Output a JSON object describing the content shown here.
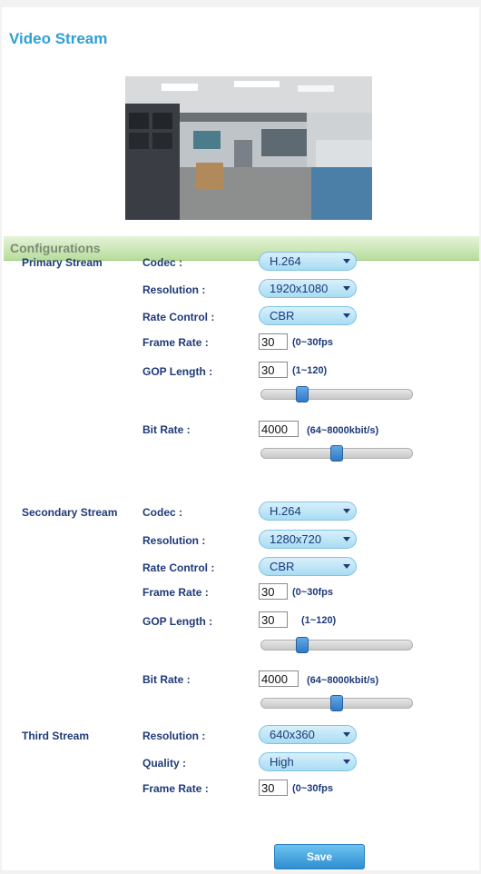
{
  "page_title": "Video Stream",
  "config_header": "Configurations",
  "primary": {
    "label": "Primary Stream",
    "codec_label": "Codec :",
    "codec": "H.264",
    "resolution_label": "Resolution :",
    "resolution": "1920x1080",
    "rate_control_label": "Rate Control :",
    "rate_control": "CBR",
    "frame_rate_label": "Frame Rate :",
    "frame_rate": "30",
    "frame_rate_range": "(0~30fps",
    "gop_label": "GOP Length :",
    "gop": "30",
    "gop_range": "(1~120)",
    "gop_slider_fraction": 0.25,
    "bit_rate_label": "Bit Rate :",
    "bit_rate": "4000",
    "bit_rate_range": "(64~8000kbit/s)",
    "bit_rate_slider_fraction": 0.5
  },
  "secondary": {
    "label": "Secondary Stream",
    "codec_label": "Codec :",
    "codec": "H.264",
    "resolution_label": "Resolution :",
    "resolution": "1280x720",
    "rate_control_label": "Rate Control :",
    "rate_control": "CBR",
    "frame_rate_label": "Frame Rate :",
    "frame_rate": "30",
    "frame_rate_range": "(0~30fps",
    "gop_label": "GOP Length :",
    "gop": "30",
    "gop_range": "(1~120)",
    "gop_slider_fraction": 0.25,
    "bit_rate_label": "Bit Rate :",
    "bit_rate": "4000",
    "bit_rate_range": "(64~8000kbit/s)",
    "bit_rate_slider_fraction": 0.5
  },
  "third": {
    "label": "Third Stream",
    "resolution_label": "Resolution :",
    "resolution": "640x360",
    "quality_label": "Quality :",
    "quality": "High",
    "frame_rate_label": "Frame Rate :",
    "frame_rate": "30",
    "frame_rate_range": "(0~30fps"
  },
  "save_label": "Save",
  "colors": {
    "title": "#2f9fd4",
    "label": "#1e3a78",
    "config_bar": "#b8dd9c",
    "select_fill": "#a9dcf3",
    "save_button": "#2f8ed0"
  },
  "icons": {
    "select_caret": "chevron-down-icon",
    "camera_preview": "camera-preview-image"
  }
}
